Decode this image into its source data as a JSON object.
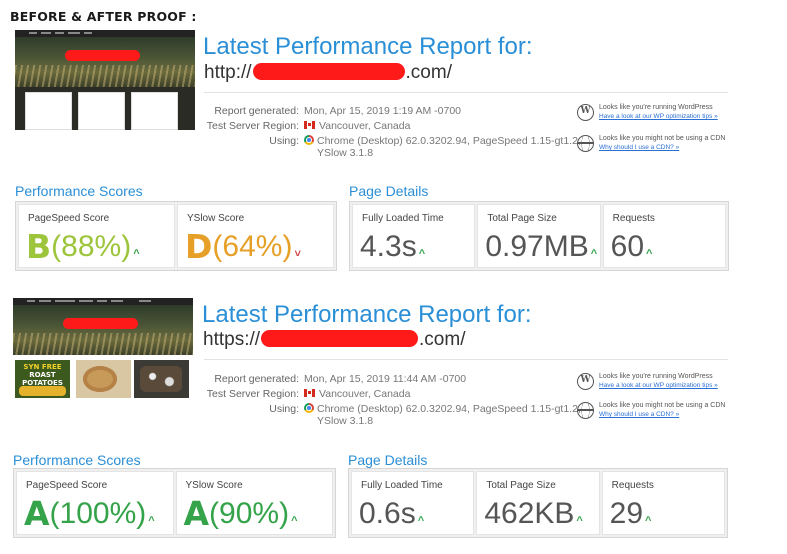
{
  "page": {
    "heading": "BEFORE & AFTER PROOF :"
  },
  "reports": [
    {
      "title": "Latest Performance Report for:",
      "url_scheme": "http://",
      "url_tld": ".com/",
      "meta": {
        "generated_label": "Report generated:",
        "generated_value": "Mon, Apr 15, 2019 1:19 AM -0700",
        "region_label": "Test Server Region:",
        "region_value": "Vancouver, Canada",
        "using_label": "Using:",
        "using_value_line1": "Chrome (Desktop) 62.0.3202.94, PageSpeed 1.15-gt1.2,",
        "using_value_line2": "YSlow 3.1.8"
      },
      "hints": {
        "wp_text": "Looks like you're running WordPress",
        "wp_link": "Have a look at our WP optimization tips »",
        "cdn_text": "Looks like you might not be using a CDN",
        "cdn_link": "Why should I use a CDN? »"
      },
      "perf_title": "Performance Scores",
      "page_title": "Page Details",
      "pagespeed": {
        "label": "PageSpeed Score",
        "grade": "B",
        "percent": "(88%)",
        "trend": "up"
      },
      "yslow": {
        "label": "YSlow Score",
        "grade": "D",
        "percent": "(64%)",
        "trend": "down"
      },
      "details": {
        "load_label": "Fully Loaded Time",
        "load_value": "4.3s",
        "size_label": "Total Page Size",
        "size_value": "0.97MB",
        "req_label": "Requests",
        "req_value": "60"
      }
    },
    {
      "title": "Latest Performance Report for:",
      "url_scheme": "https://",
      "url_tld": ".com/",
      "meta": {
        "generated_label": "Report generated:",
        "generated_value": "Mon, Apr 15, 2019 11:44 AM -0700",
        "region_label": "Test Server Region:",
        "region_value": "Vancouver, Canada",
        "using_label": "Using:",
        "using_value_line1": "Chrome (Desktop) 62.0.3202.94, PageSpeed 1.15-gt1.2,",
        "using_value_line2": "YSlow 3.1.8"
      },
      "hints": {
        "wp_text": "Looks like you're running WordPress",
        "wp_link": "Have a look at our WP optimization tips »",
        "cdn_text": "Looks like you might not be using a CDN",
        "cdn_link": "Why should I use a CDN? »"
      },
      "thumb_food_text_1": "SYN FREE",
      "thumb_food_text_2": "ROAST",
      "thumb_food_text_3": "POTATOES",
      "perf_title": "Performance Scores",
      "page_title": "Page Details",
      "pagespeed": {
        "label": "PageSpeed Score",
        "grade": "A",
        "percent": "(100%)",
        "trend": "up"
      },
      "yslow": {
        "label": "YSlow Score",
        "grade": "A",
        "percent": "(90%)",
        "trend": "up"
      },
      "details": {
        "load_label": "Fully Loaded Time",
        "load_value": "0.6s",
        "size_label": "Total Page Size",
        "size_value": "462KB",
        "req_label": "Requests",
        "req_value": "29"
      }
    }
  ],
  "arrows": {
    "up": "^",
    "down": "˅"
  },
  "colors": {
    "title_blue": "#2a8fd6",
    "grade_b": "#9dc53c",
    "grade_d": "#e6a028",
    "grade_a": "#34a34a",
    "trend_up": "#34a34a",
    "trend_down": "#d04040",
    "redaction": "#ff1a1a"
  }
}
